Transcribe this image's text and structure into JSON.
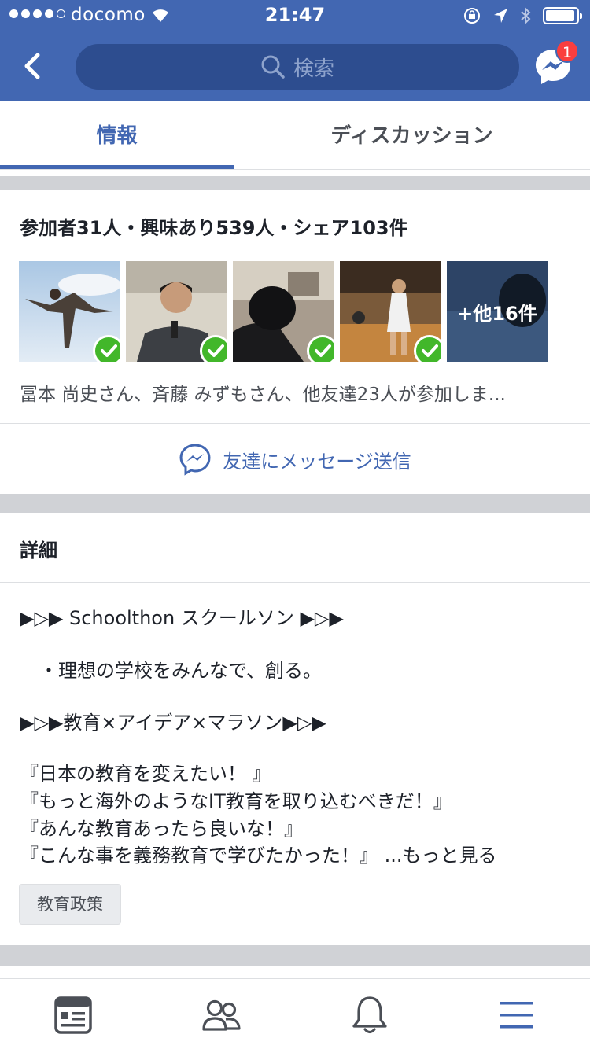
{
  "status_bar": {
    "carrier": "docomo",
    "time": "21:47"
  },
  "nav": {
    "search_placeholder": "検索",
    "messenger_badge": "1"
  },
  "tabs": [
    {
      "label": "情報",
      "active": true
    },
    {
      "label": "ディスカッション",
      "active": false
    }
  ],
  "attendees": {
    "summary": "参加者31人・興味あり539人・シェア103件",
    "more_label": "+他16件",
    "names_text": "冨本 尚史さん、斉藤 みずもさん、他友達23人が参加しま...",
    "message_label": "友達にメッセージ送信"
  },
  "details": {
    "title": "詳細",
    "lines": [
      "▶▷▶ Schoolthon スクールソン ▶▷▶",
      "・理想の学校をみんなで、創る。",
      "▶▷▶教育×アイデア×マラソン▶▷▶",
      "『日本の教育を変えたい！ 』",
      "『もっと海外のようなIT教育を取り込むべきだ！』",
      "『あんな教育あったら良いな！』",
      "『こんな事を義務教育で学びたかった！』"
    ],
    "more_link": "...もっと見る",
    "tag": "教育政策"
  },
  "colors": {
    "brand_blue": "#4267b2",
    "badge_red": "#fa3e3e",
    "check_green": "#42b72a"
  }
}
